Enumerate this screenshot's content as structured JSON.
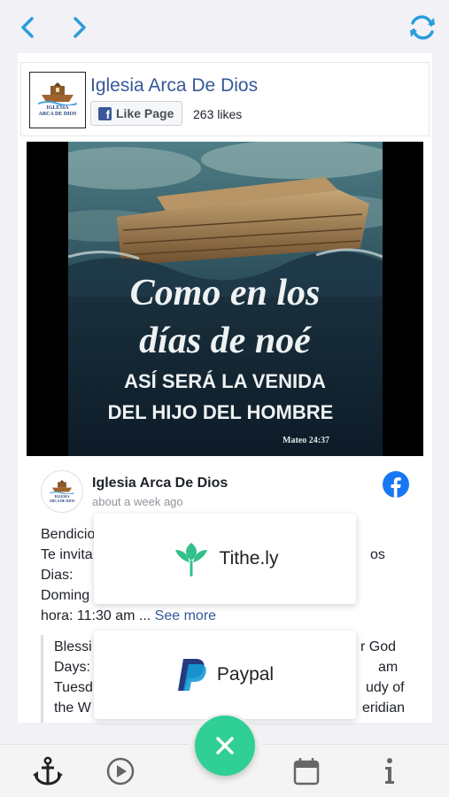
{
  "colors": {
    "accent": "#2a9ddb",
    "facebook": "#3b5998",
    "link": "#365899",
    "fab": "#2fcf96",
    "tithe_green": "#34c08b",
    "paypal_dark": "#253b80",
    "paypal_light": "#179bd7"
  },
  "topbar": {
    "back_icon": "chevron-left-icon",
    "forward_icon": "chevron-right-icon",
    "refresh_icon": "refresh-icon"
  },
  "page_plugin": {
    "logo_text_1": "IGLESIA",
    "logo_text_2": "ARCA DE DIOS",
    "name": "Iglesia Arca De Dios",
    "like_button_label": "Like Page",
    "likes": "263 likes"
  },
  "post": {
    "image_line_1": "Como en los",
    "image_line_2": "días de noé",
    "image_line_3": "ASÍ SERÁ LA VENIDA",
    "image_line_4": "DEL HIJO DEL HOMBRE",
    "image_reference": "Mateo 24:37",
    "author": "Iglesia Arca De Dios",
    "time": "about a week ago",
    "lines": [
      "Bendicio",
      "Te invita",
      "Dias:",
      "Doming"
    ],
    "line_fragment_right": "os",
    "hour_line": "hora: 11:30 am ... ",
    "see_more": "See more",
    "quote_left": [
      "Blessi",
      "Days:",
      "Tuesd",
      "the W"
    ],
    "quote_right": [
      "r God",
      "am",
      "udy of",
      "eridian"
    ]
  },
  "popups": {
    "tithe_label": "Tithe.ly",
    "paypal_label": "Paypal"
  },
  "tabbar": {
    "anchor_icon": "anchor-icon",
    "play_icon": "play-icon",
    "fab_icon": "close-icon",
    "calendar_icon": "calendar-icon",
    "info_icon": "info-icon"
  }
}
